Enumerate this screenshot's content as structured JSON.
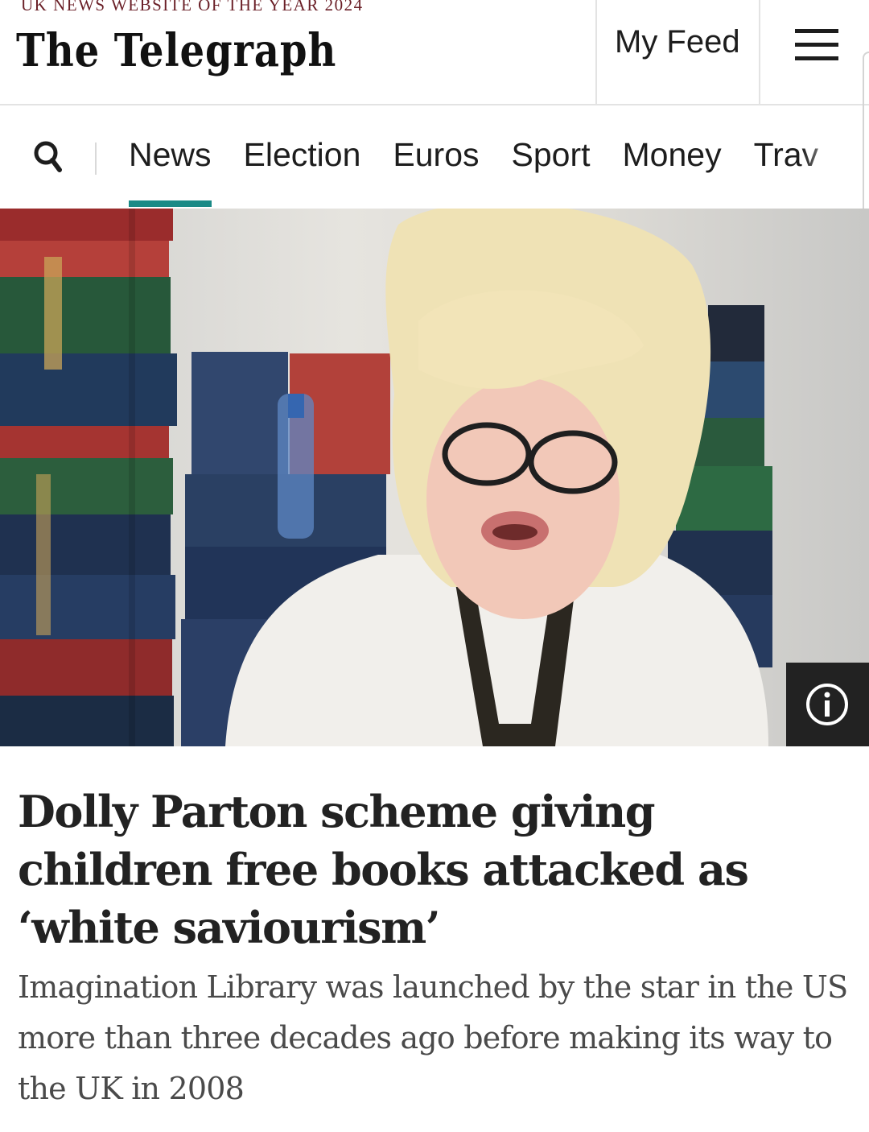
{
  "masthead": {
    "award": "UK NEWS WEBSITE OF THE YEAR 2024",
    "logo": "The Telegraph",
    "my_feed_label": "My Feed",
    "menu_icon": "hamburger-menu-icon"
  },
  "nav": {
    "search_icon": "search-icon",
    "items": [
      {
        "label": "News",
        "active": true
      },
      {
        "label": "Election"
      },
      {
        "label": "Euros"
      },
      {
        "label": "Sport"
      },
      {
        "label": "Money"
      },
      {
        "label": "Trav"
      }
    ],
    "accent_color": "#1a8a86"
  },
  "hero": {
    "info_icon": "info-icon"
  },
  "article": {
    "headline": "Dolly Parton scheme giving children free books attacked as ‘white saviourism’",
    "standfirst": "Imagination Library was launched by the star in the US more than three decades ago before making its way to the UK in 2008"
  }
}
